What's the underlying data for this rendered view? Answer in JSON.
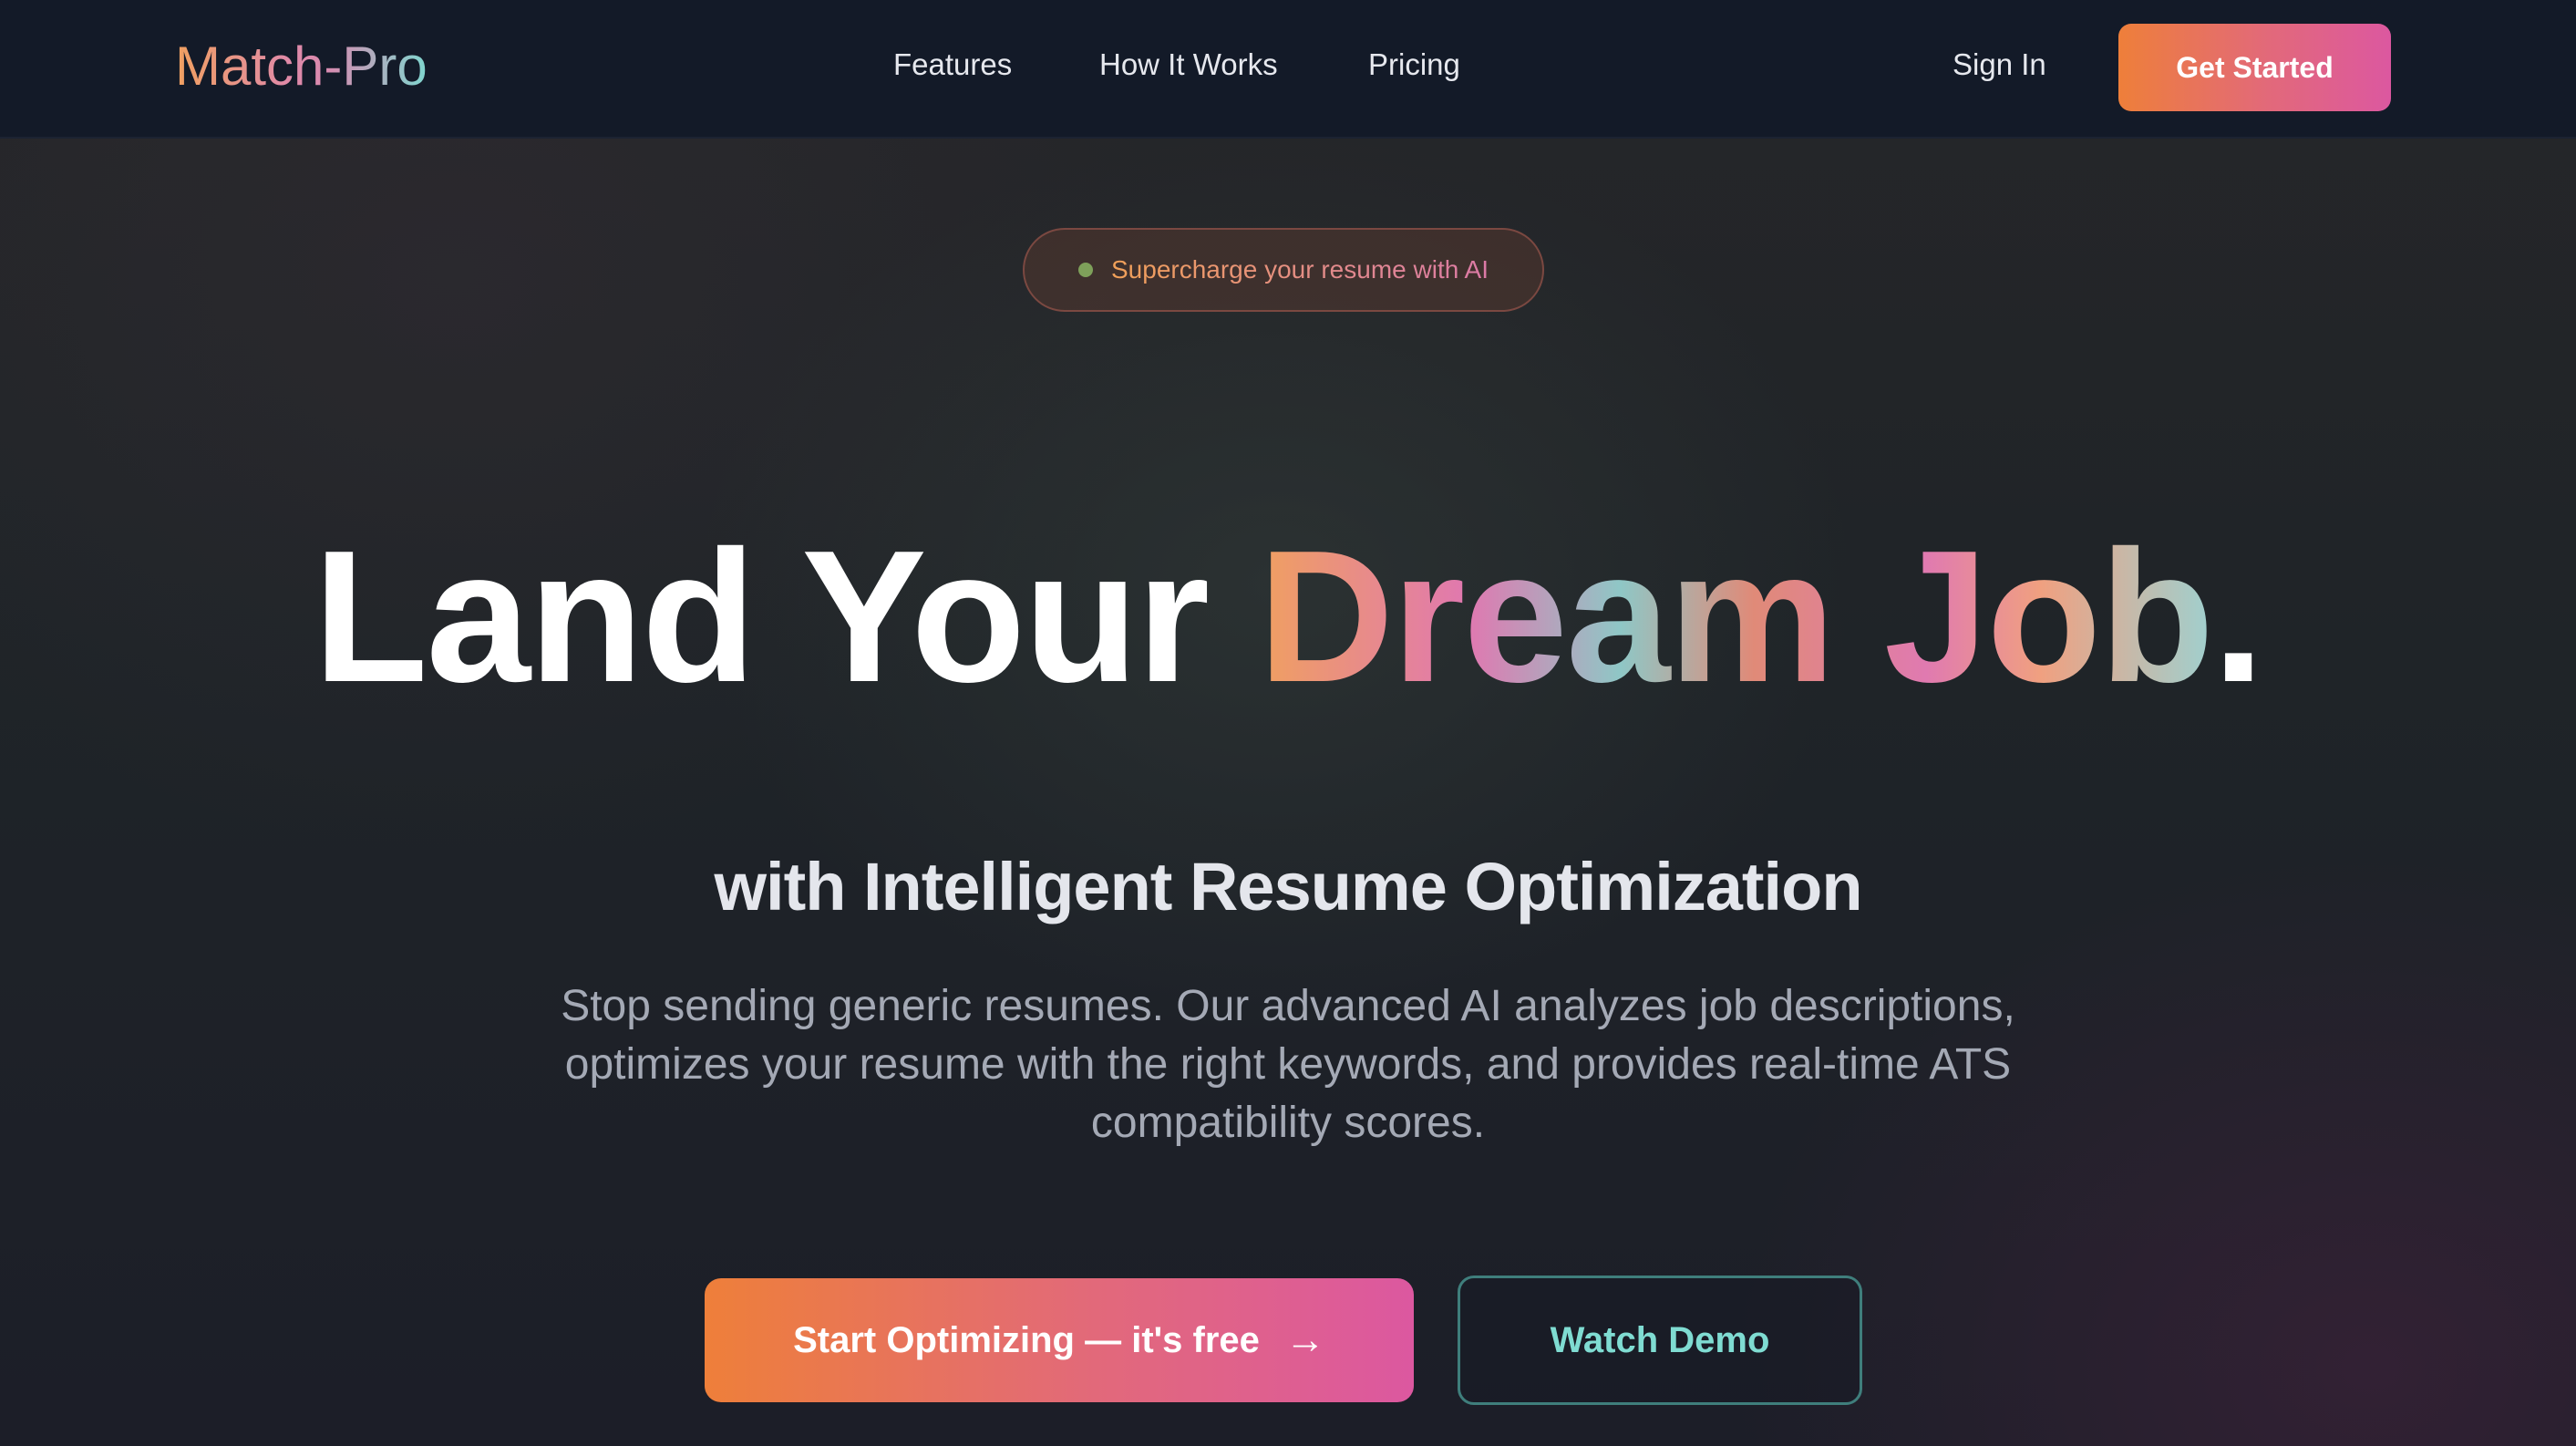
{
  "nav": {
    "logo": "Match-Pro",
    "links": [
      "Features",
      "How It Works",
      "Pricing"
    ],
    "sign_in": "Sign In",
    "get_started": "Get Started"
  },
  "hero": {
    "badge": "Supercharge your resume with AI",
    "headline_plain": "Land Your ",
    "headline_gradient": "Dream Job",
    "headline_end": ".",
    "subheadline": "with Intelligent Resume Optimization",
    "description": "Stop sending generic resumes. Our advanced AI analyzes job descriptions, optimizes your resume with the right keywords, and provides real-time ATS compatibility scores.",
    "primary_cta": "Start Optimizing — it's free",
    "primary_cta_icon": "→",
    "secondary_cta": "Watch Demo"
  },
  "colors": {
    "background": "#161b27",
    "nav_background": "#131a28",
    "accent_orange": "#ee7f3a",
    "accent_pink": "#dc58a0",
    "accent_teal": "#7fdcd2",
    "badge_dot": "#7ea05a"
  },
  "icons": {
    "badge_dot": "status-dot-icon",
    "cta_arrow": "arrow-right-icon"
  }
}
